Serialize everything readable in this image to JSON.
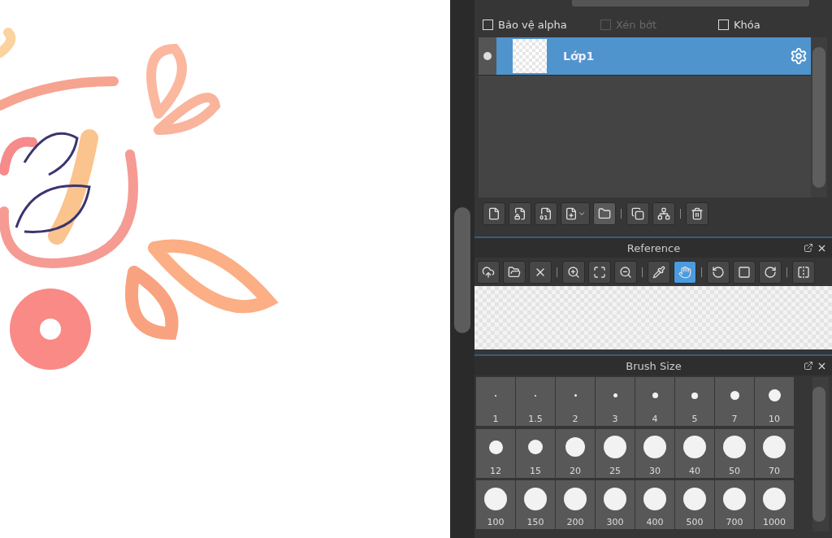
{
  "layer_options": [
    {
      "label": "Bảo vệ alpha",
      "checked": false,
      "disabled": false
    },
    {
      "label": "Xén bớt",
      "checked": false,
      "disabled": true
    },
    {
      "label": "Khóa",
      "checked": false,
      "disabled": false
    }
  ],
  "layers": [
    {
      "name": "Lớp1",
      "selected": true,
      "visible": true
    }
  ],
  "layer_tools": [
    {
      "selected": false
    },
    {
      "selected": false
    },
    {
      "selected": false
    },
    {
      "selected": false
    },
    {
      "selected": true
    },
    {
      "selected": false
    },
    {
      "selected": false
    },
    {
      "selected": false
    }
  ],
  "reference": {
    "title": "Reference",
    "tools": [
      {
        "selected": false
      },
      {
        "selected": false
      },
      {
        "selected": false
      },
      {
        "selected": false
      },
      {
        "selected": false
      },
      {
        "selected": false
      },
      {
        "selected": false
      },
      {
        "selected": true
      },
      {
        "selected": false
      },
      {
        "selected": false
      },
      {
        "selected": false
      },
      {
        "selected": false
      }
    ]
  },
  "brush_size": {
    "title": "Brush Size",
    "sizes": [
      "1",
      "1.5",
      "2",
      "3",
      "4",
      "5",
      "7",
      "10",
      "12",
      "15",
      "20",
      "25",
      "30",
      "40",
      "50",
      "70",
      "100",
      "150",
      "200",
      "300",
      "400",
      "500",
      "700",
      "1000"
    ]
  }
}
